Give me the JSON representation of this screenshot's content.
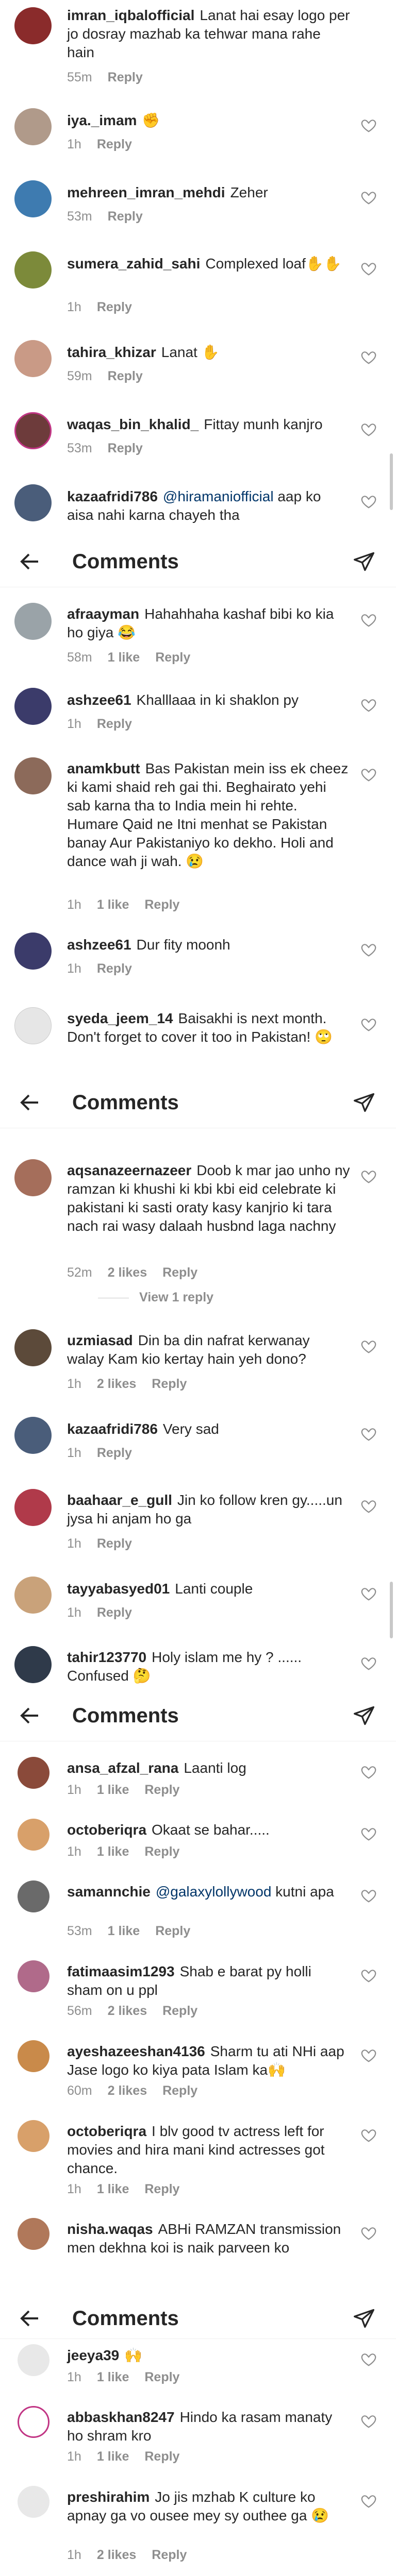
{
  "header_title": "Comments",
  "comments": [
    {
      "user": "imran_iqbalofficial",
      "text": "Lanat hai esay logo per jo dosray mazhab ka tehwar mana rahe hain",
      "time": "55m",
      "likes": "",
      "reply": "Reply"
    },
    {
      "user": "iya._imam",
      "text": "✊",
      "time": "1h",
      "likes": "",
      "reply": "Reply"
    },
    {
      "user": "mehreen_imran_mehdi",
      "text": "Zeher",
      "time": "53m",
      "likes": "",
      "reply": "Reply"
    },
    {
      "user": "sumera_zahid_sahi",
      "text": "Complexed loaf✋✋",
      "time": "1h",
      "likes": "",
      "reply": "Reply"
    },
    {
      "user": "tahira_khizar",
      "text": "Lanat ✋",
      "time": "59m",
      "likes": "",
      "reply": "Reply"
    },
    {
      "user": "waqas_bin_khalid_",
      "text": "Fittay munh kanjro",
      "time": "53m",
      "likes": "",
      "reply": "Reply"
    },
    {
      "user": "kazaafridi786",
      "mention": "@hiramaniofficial",
      "text": " aap ko aisa nahi karna chayeh tha",
      "time": "",
      "likes": "",
      "reply": ""
    },
    {
      "user": "afraayman",
      "text": "Hahahhaha kashaf bibi ko kia ho giya 😂",
      "time": "58m",
      "likes": "1 like",
      "reply": "Reply"
    },
    {
      "user": "ashzee61",
      "text": "Khalllaaa in ki shaklon py",
      "time": "1h",
      "likes": "",
      "reply": "Reply"
    },
    {
      "user": "anamkbutt",
      "text": "Bas Pakistan mein iss ek cheez ki kami shaid reh gai thi. Beghairato yehi sab karna tha to India mein hi rehte. Humare Qaid ne Itni menhat se Pakistan banay Aur Pakistaniyo ko dekho. Holi and dance wah ji wah. 😢",
      "time": "1h",
      "likes": "1 like",
      "reply": "Reply"
    },
    {
      "user": "ashzee61",
      "text": "Dur fity moonh",
      "time": "1h",
      "likes": "",
      "reply": "Reply"
    },
    {
      "user": "syeda_jeem_14",
      "text": "Baisakhi is next month. Don't forget to cover it too in Pakistan! 🙄",
      "time": "",
      "likes": "",
      "reply": ""
    },
    {
      "user": "aqsanazeernazeer",
      "text": "Doob k mar jao unho ny ramzan ki khushi ki kbi kbi eid celebrate ki pakistani ki sasti oraty kasy kanjrio ki tara nach rai wasy dalaah husbnd laga nachny",
      "time": "52m",
      "likes": "2 likes",
      "reply": "Reply"
    },
    {
      "user": "uzmiasad",
      "text": "Din ba din nafrat kerwanay walay Kam kio kertay hain yeh dono?",
      "time": "1h",
      "likes": "2 likes",
      "reply": "Reply"
    },
    {
      "user": "kazaafridi786",
      "text": "Very sad",
      "time": "1h",
      "likes": "",
      "reply": "Reply"
    },
    {
      "user": "baahaar_e_gull",
      "text": "Jin ko follow kren gy.....un jysa hi anjam ho ga",
      "time": "1h",
      "likes": "",
      "reply": "Reply"
    },
    {
      "user": "tayyabasyed01",
      "text": "Lanti couple",
      "time": "1h",
      "likes": "",
      "reply": "Reply"
    },
    {
      "user": "tahir123770",
      "text": "Holy islam me hy ? ...... Confused 🤔",
      "time": "",
      "likes": "",
      "reply": ""
    },
    {
      "user": "ansa_afzal_rana",
      "text": "Laanti log",
      "time": "1h",
      "likes": "1 like",
      "reply": "Reply"
    },
    {
      "user": "octoberiqra",
      "text": "Okaat se bahar.....",
      "time": "1h",
      "likes": "1 like",
      "reply": "Reply"
    },
    {
      "user": "samannchie",
      "mention": "@galaxylollywood",
      "text": " kutni apa",
      "time": "53m",
      "likes": "1 like",
      "reply": "Reply"
    },
    {
      "user": "fatimaasim1293",
      "text": "Shab e barat py holli sham on u ppl",
      "time": "56m",
      "likes": "2 likes",
      "reply": "Reply"
    },
    {
      "user": "ayeshazeeshan4136",
      "text": "Sharm tu ati NHi aap Jase logo ko kiya pata Islam ka🙌",
      "time": "60m",
      "likes": "2 likes",
      "reply": "Reply"
    },
    {
      "user": "octoberiqra",
      "text": "I blv good tv actress left for movies and hira mani kind actresses got chance.",
      "time": "1h",
      "likes": "1 like",
      "reply": "Reply"
    },
    {
      "user": "nisha.waqas",
      "text": "ABHi RAMZAN transmission men dekhna koi is naik parveen ko",
      "time": "",
      "likes": "",
      "reply": ""
    },
    {
      "user": "jeeya39",
      "text": "🙌",
      "time": "1h",
      "likes": "1 like",
      "reply": "Reply"
    },
    {
      "user": "abbaskhan8247",
      "text": "Hindo ka rasam manaty ho shram kro",
      "time": "1h",
      "likes": "1 like",
      "reply": "Reply"
    },
    {
      "user": "preshirahim",
      "text": "Jo jis mzhab K culture ko apnay ga vo ousee mey sy outhee ga 😢",
      "time": "1h",
      "likes": "2 likes",
      "reply": "Reply"
    }
  ],
  "view_replies": "View 1 reply",
  "colors": {
    "avatar_palette": [
      "#8a5a44",
      "#c9a27a",
      "#5b6e8c",
      "#a0785a",
      "#d3b48f",
      "#6d4c41",
      "#b08a6e",
      "#7b8fa1"
    ]
  }
}
